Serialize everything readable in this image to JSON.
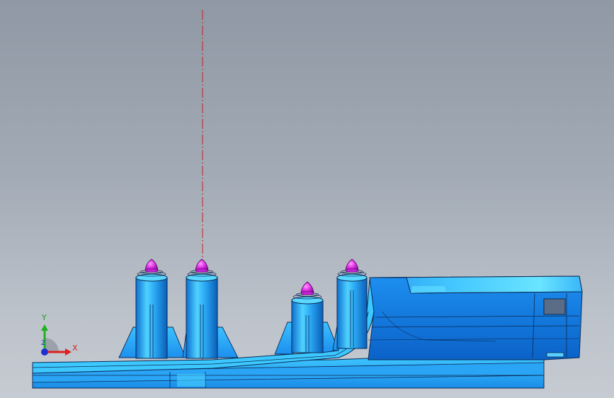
{
  "viewport": {
    "background_top": "#8f98a4",
    "background_bottom": "#c6cbd2"
  },
  "model": {
    "body_color": "#1e90f0",
    "highlight_color": "#5ad0ff",
    "pin_color": "#d020d8",
    "centerline_color": "#c8202a"
  },
  "triad": {
    "x_label": "X",
    "y_label": "Y",
    "z_label": "Z",
    "x_color": "#e01f1f",
    "y_color": "#1fb21f",
    "z_color": "#1f2fd0"
  }
}
